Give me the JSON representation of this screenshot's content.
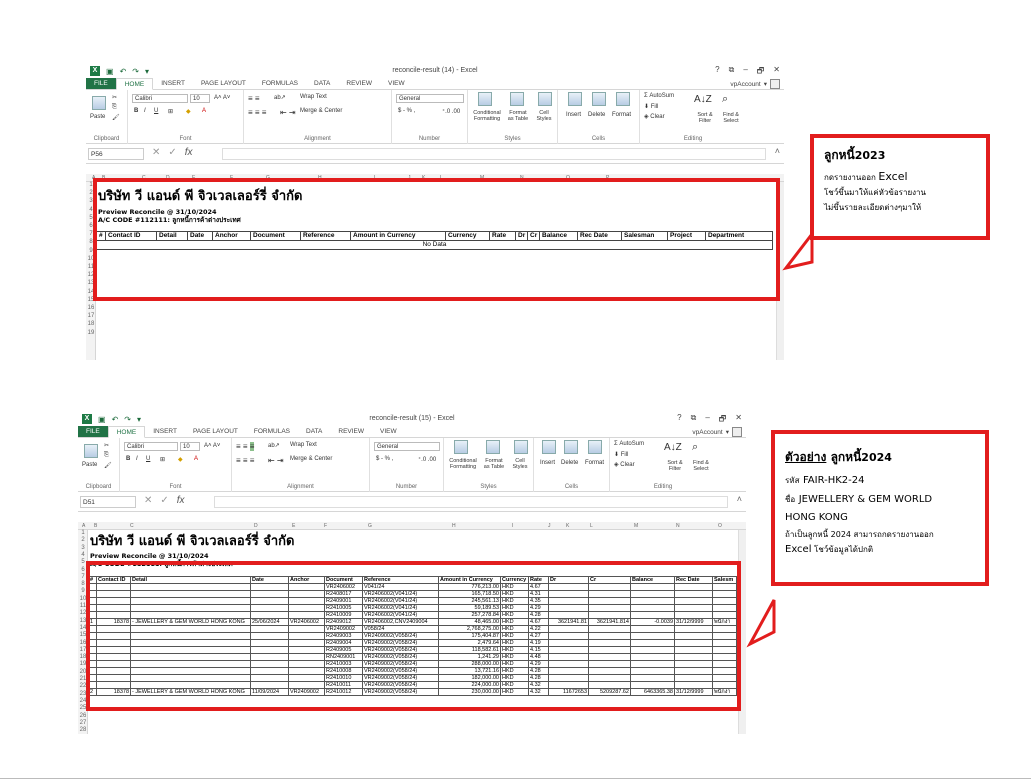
{
  "windows": [
    {
      "title": "reconcile-result (14) - Excel",
      "controls": [
        "?",
        "⧉",
        "–",
        "🗗",
        "✕"
      ],
      "tabs": [
        "FILE",
        "HOME",
        "INSERT",
        "PAGE LAYOUT",
        "FORMULAS",
        "DATA",
        "REVIEW",
        "VIEW"
      ],
      "account": "vpAccount",
      "ribbon": {
        "paste": "Paste",
        "font_name": "Calibri",
        "font_size": "10",
        "wrap_text": "Wrap Text",
        "merge_center": "Merge & Center",
        "number_format": "General",
        "currency": "$ - % ,",
        "conditional": "Conditional Formatting",
        "format_table": "Format as Table",
        "cell_styles": "Cell Styles",
        "insert": "Insert",
        "delete": "Delete",
        "format": "Format",
        "autosum": "AutoSum",
        "fill": "Fill",
        "clear": "Clear",
        "sort": "Sort & Filter",
        "find": "Find & Select",
        "groups": [
          "Clipboard",
          "Font",
          "Alignment",
          "Number",
          "Styles",
          "Cells",
          "Editing"
        ]
      },
      "name_box": "P56",
      "columns": [
        "A",
        "B",
        "C",
        "D",
        "E",
        "F",
        "G",
        "H",
        "I",
        "J",
        "K",
        "L",
        "M",
        "N",
        "O",
        "P"
      ],
      "rows": [
        "1",
        "2",
        "3",
        "4",
        "5",
        "6",
        "7",
        "8",
        "9",
        "10",
        "11",
        "12",
        "13",
        "14",
        "15",
        "16",
        "17",
        "18",
        "19"
      ],
      "company": "บริษัท วี แอนด์ พี จิวเวลเลอร์รี่ จำกัด",
      "line1": "Preview Reconcile @ 31/10/2024",
      "line2": "A/C CODE #112111: ลูกหนี้การค้าต่างประเทศ",
      "headers": [
        "#",
        "Contact ID",
        "Detail",
        "Date",
        "Anchor",
        "Document",
        "Reference",
        "Amount in Currency",
        "Currency",
        "Rate",
        "Dr",
        "Cr",
        "Balance",
        "Rec Date",
        "Salesman",
        "Project",
        "Department"
      ],
      "no_data": "No Data"
    },
    {
      "title": "reconcile-result (15) - Excel",
      "controls": [
        "?",
        "⧉",
        "–",
        "🗗",
        "✕"
      ],
      "tabs": [
        "FILE",
        "HOME",
        "INSERT",
        "PAGE LAYOUT",
        "FORMULAS",
        "DATA",
        "REVIEW",
        "VIEW"
      ],
      "account": "vpAccount",
      "ribbon": {
        "paste": "Paste",
        "font_name": "Calibri",
        "font_size": "10",
        "wrap_text": "Wrap Text",
        "merge_center": "Merge & Center",
        "number_format": "General",
        "currency": "$ - % ,",
        "conditional": "Conditional Formatting",
        "format_table": "Format as Table",
        "cell_styles": "Cell Styles",
        "insert": "Insert",
        "delete": "Delete",
        "format": "Format",
        "autosum": "AutoSum",
        "fill": "Fill",
        "clear": "Clear",
        "sort": "Sort & Filter",
        "find": "Find & Select",
        "groups": [
          "Clipboard",
          "Font",
          "Alignment",
          "Number",
          "Styles",
          "Cells",
          "Editing"
        ]
      },
      "name_box": "D51",
      "columns": [
        "A",
        "B",
        "C",
        "D",
        "E",
        "F",
        "G",
        "H",
        "I",
        "J",
        "K",
        "L",
        "M",
        "N",
        "O"
      ],
      "rows": [
        "1",
        "2",
        "3",
        "4",
        "5",
        "6",
        "7",
        "8",
        "9",
        "10",
        "11",
        "12",
        "13",
        "14",
        "15",
        "16",
        "17",
        "18",
        "19",
        "20",
        "21",
        "22",
        "23",
        "24",
        "25",
        "26",
        "27",
        "28"
      ],
      "company": "บริษัท วี แอนด์ พี จิวเวลเลอร์รี่ จำกัด",
      "line1": "Preview Reconcile @ 31/10/2024",
      "line2": "A/C CODE #112111: ลูกหนี้การค้าต่างประเทศ",
      "headers": [
        "#",
        "Contact ID",
        "Detail",
        "Date",
        "Anchor",
        "Document",
        "Reference",
        "Amount in Currency",
        "Currency",
        "Rate",
        "Dr",
        "Cr",
        "Balance",
        "Rec Date",
        "Salesm"
      ],
      "detail_rows": [
        {
          "doc": "VR2406002",
          "ref": "V041/24",
          "amt": "776,213.00",
          "cur": "HKD",
          "rate": "4.67"
        },
        {
          "doc": "R2408017",
          "ref": "VR2406002(V041/24)",
          "amt": "165,718.50",
          "cur": "HKD",
          "rate": "4.31"
        },
        {
          "doc": "R2409001",
          "ref": "VR2406002(V041/24)",
          "amt": "245,561.13",
          "cur": "HKD",
          "rate": "4.35"
        },
        {
          "doc": "R2410005",
          "ref": "VR2406002(V041/24)",
          "amt": "59,189.53",
          "cur": "HKD",
          "rate": "4.29"
        },
        {
          "doc": "R2410009",
          "ref": "VR2406002(V041/24)",
          "amt": "257,278.84",
          "cur": "HKD",
          "rate": "4.28"
        },
        {
          "no": "1",
          "contact": "18378",
          "detail": "- JEWELLERY & GEM WORLD HONG KONG",
          "date": "25/06/2024",
          "anchor": "VR2406002",
          "doc": "R2409012",
          "ref": "VR2406002,CNV2409004",
          "amt": "48,465.00",
          "cur": "HKD",
          "rate": "4.67",
          "dr": "3621941.81",
          "cr": "3621941.814",
          "bal": "-0.0039",
          "rec": "31/12/9999",
          "sales": "พนักงา"
        },
        {
          "doc": "VR2409002",
          "ref": "V058/24",
          "amt": "2,768,275.00",
          "cur": "HKD",
          "rate": "4.22"
        },
        {
          "doc": "R2409003",
          "ref": "VR2409002(V058/24)",
          "amt": "175,404.87",
          "cur": "HKD",
          "rate": "4.27"
        },
        {
          "doc": "R2409004",
          "ref": "VR2409002(V058/24)",
          "amt": "2,479.64",
          "cur": "HKD",
          "rate": "4.19"
        },
        {
          "doc": "R2409005",
          "ref": "VR2409002(V058/24)",
          "amt": "118,582.61",
          "cur": "HKD",
          "rate": "4.15"
        },
        {
          "doc": "RN2409001",
          "ref": "VR2409002(V058/24)",
          "amt": "1,241.29",
          "cur": "HKD",
          "rate": "4.48"
        },
        {
          "doc": "R2410003",
          "ref": "VR2409002(V058/24)",
          "amt": "288,000.00",
          "cur": "HKD",
          "rate": "4.29"
        },
        {
          "doc": "R2410008",
          "ref": "VR2409002(V058/24)",
          "amt": "13,721.16",
          "cur": "HKD",
          "rate": "4.28"
        },
        {
          "doc": "R2410010",
          "ref": "VR2409002(V058/24)",
          "amt": "182,000.00",
          "cur": "HKD",
          "rate": "4.28"
        },
        {
          "doc": "R2410011",
          "ref": "VR2409002(V058/24)",
          "amt": "224,000.00",
          "cur": "HKD",
          "rate": "4.32"
        },
        {
          "no": "2",
          "contact": "18378",
          "detail": "- JEWELLERY & GEM WORLD HONG KONG",
          "date": "11/09/2024",
          "anchor": "VR2409002",
          "doc": "R2410012",
          "ref": "VR2409002(V058/24)",
          "amt": "230,000.00",
          "cur": "HKD",
          "rate": "4.32",
          "dr": "11672653",
          "cr": "5209287.62",
          "bal": "6463365.38",
          "rec": "31/12/9999",
          "sales": "พนักงา"
        }
      ]
    }
  ],
  "callout1": {
    "title": "ลูกหนี้",
    "year": "2023",
    "line1a": "กดรายงานออก",
    "line1b": "Excel",
    "line2": "โชว์ขึ้นมาให้แค่หัวข้อรายงาน",
    "line3": "ไม่ขึ้นรายละเอียดต่างๆมาให้"
  },
  "callout2": {
    "title_u": "ตัวอย่าง",
    "title": "ลูกหนี้",
    "year": "2024",
    "code_label": "รหัส",
    "code": "FAIR-HK2-24",
    "name_label": "ชื่อ",
    "name1": "JEWELLERY & GEM WORLD",
    "name2": "HONG KONG",
    "line4": "ถ้าเป็นลูกหนี้ 2024 สามารถกดรายงานออก",
    "line5a": "Excel",
    "line5b": "โชว์ข้อมูลได้ปกติ"
  },
  "colors": {
    "red": "#e21d1d",
    "excel_green": "#217346"
  }
}
